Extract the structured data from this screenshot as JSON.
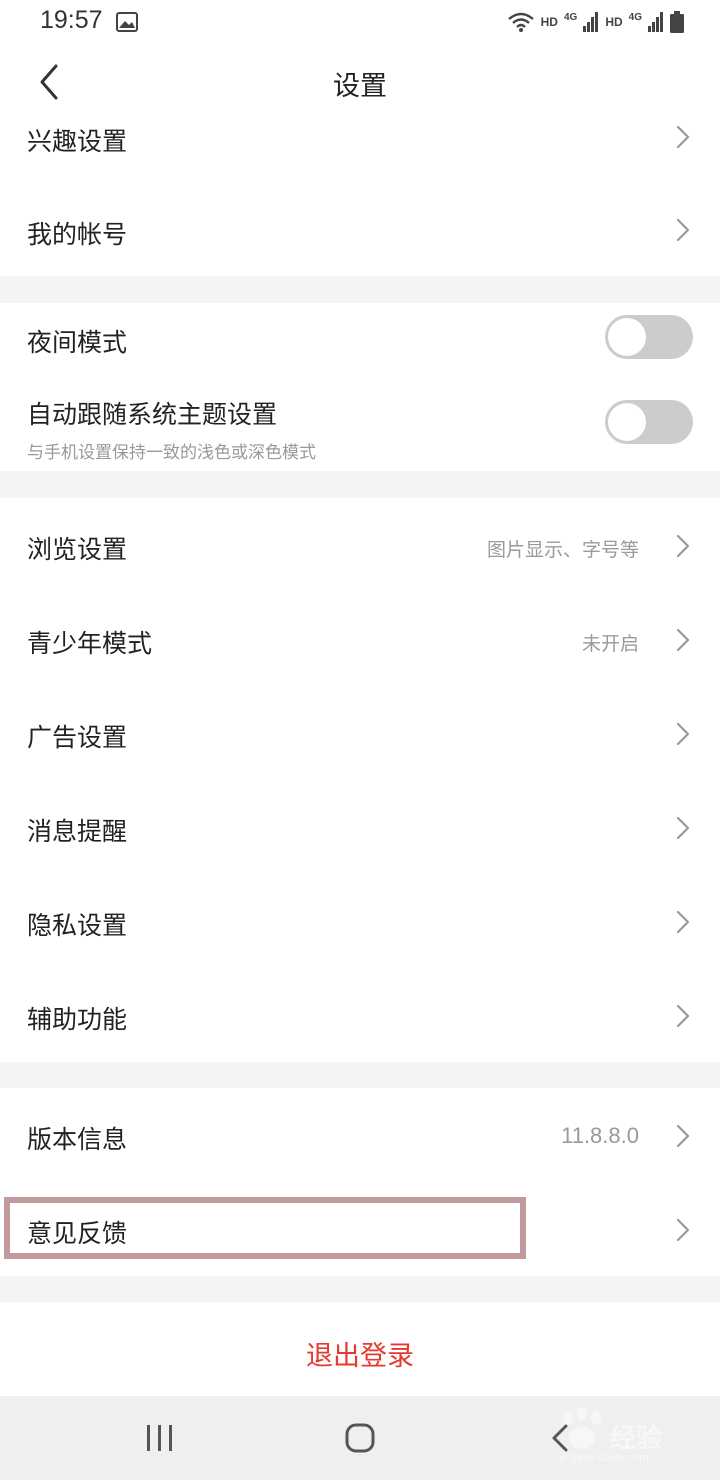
{
  "status_bar": {
    "time": "19:57",
    "image_icon": "image-icon",
    "signal_label_1": "HD",
    "net_label_1": "4G",
    "signal_label_2": "HD",
    "net_label_2": "4G"
  },
  "header": {
    "title": "设置",
    "back_icon": "chevron-left-icon"
  },
  "section1": {
    "interest": {
      "label": "兴趣设置"
    },
    "account": {
      "label": "我的帐号"
    }
  },
  "section2": {
    "night_mode": {
      "label": "夜间模式",
      "on": false
    },
    "follow_system": {
      "label": "自动跟随系统主题设置",
      "sub": "与手机设置保持一致的浅色或深色模式",
      "on": false
    }
  },
  "section3": {
    "browse": {
      "label": "浏览设置",
      "value": "图片显示、字号等"
    },
    "youth": {
      "label": "青少年模式",
      "value": "未开启"
    },
    "ads": {
      "label": "广告设置"
    },
    "notify": {
      "label": "消息提醒"
    },
    "privacy": {
      "label": "隐私设置"
    },
    "accessibility": {
      "label": "辅助功能"
    }
  },
  "section4": {
    "version": {
      "label": "版本信息",
      "value": "11.8.8.0"
    },
    "feedback": {
      "label": "意见反馈"
    }
  },
  "logout": {
    "label": "退出登录"
  },
  "colors": {
    "accent_red": "#e6382f",
    "highlight_border": "#c29a9c",
    "section_gap": "#f4f4f4",
    "toggle_off": "#cccccc"
  },
  "watermark": {
    "text": "经验",
    "url": "jingyan.baidu.com"
  }
}
